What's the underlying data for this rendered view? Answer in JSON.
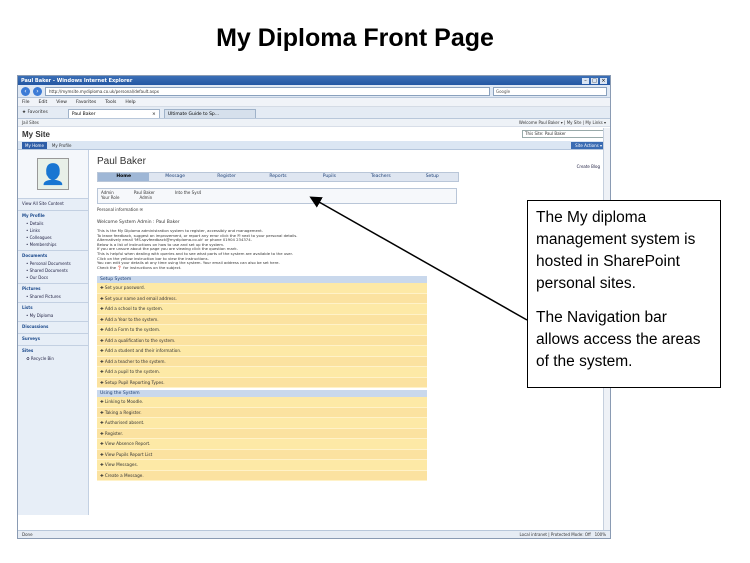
{
  "slide": {
    "title": "My Diploma Front Page"
  },
  "browser": {
    "window_title": "Paul Baker - Windows Internet Explorer",
    "address": "http://mymsite.mydiploma.co.uk/personal/default.aspx",
    "search_placeholder": "Google",
    "menu": [
      "File",
      "Edit",
      "View",
      "Favorites",
      "Tools",
      "Help"
    ],
    "favorites_label": "Favorites",
    "tabs": [
      "Paul Baker",
      "Ultimate Guide to Sp..."
    ],
    "status_left": "Done",
    "status_right": "Local intranet | Protected Mode: Off",
    "zoom": "100%"
  },
  "sharepoint": {
    "top_left": "Jail Sites",
    "welcome": "Welcome Paul Baker ▾ | My Site | My Links ▾",
    "site_title": "My Site",
    "site_search": "This Site: Paul Baker",
    "tabs": [
      "My Home",
      "My Profile"
    ],
    "site_actions": "Site Actions ▾",
    "create_blog": "Create Blog"
  },
  "quicklaunch": {
    "view_all": "View All Site Content",
    "groups": [
      {
        "head": "My Profile",
        "items": [
          "Details",
          "Links",
          "Colleagues",
          "Memberships"
        ]
      },
      {
        "head": "Documents",
        "items": [
          "Personal Documents",
          "Shared Documents",
          "Our Docs"
        ]
      },
      {
        "head": "Pictures",
        "items": [
          "Shared Pictures"
        ]
      },
      {
        "head": "Lists",
        "items": [
          "My Diploma"
        ]
      },
      {
        "head": "Discussions",
        "items": []
      },
      {
        "head": "Surveys",
        "items": []
      },
      {
        "head": "Sites",
        "items": []
      }
    ],
    "recycle": "Recycle Bin"
  },
  "main": {
    "page_title": "Paul Baker",
    "nav": [
      "Home",
      "Message",
      "Register",
      "Reports",
      "Pupils",
      "Teachers",
      "Setup"
    ],
    "info_rows": [
      [
        "Admin",
        "Paul Baker",
        "Into the Sys4"
      ],
      [
        "Your Role",
        "Admin",
        ""
      ]
    ],
    "content_line": "Personal information ✉",
    "welcome": "Welcome System Admin : Paul Baker",
    "paragraph": [
      "This is the My Diploma administration system to register, accessibly and management.",
      "To leave feedback, suggest an improvement, or report any error click the ✉ next to your personal details.",
      "Alternatively email 'MS.spvfeedback@mydiploma.co.uk' or phone 01904 234374.",
      "Below is a list of instructions on how to use and set up the system.",
      "If you are unsure about the page you are viewing click the question mark.",
      "This is helpful when dealing with queries and to see what parts of the system are available to the user.",
      "Click on the yellow instruction bar to view the instructions.",
      "You can edit your details at any time using the system. Your email address can also be set here.",
      "Check the ❓ for instructions on the subject."
    ],
    "setup_section": {
      "head": "Setup System",
      "items": [
        "Set your password.",
        "Set your name and email address.",
        "Add a school to the system.",
        "Add a Year to the system.",
        "Add a Form to the system.",
        "Add a qualification to the system.",
        "Add a student and their information.",
        "Add a teacher to the system.",
        "Add a pupil to the system.",
        "Setup Pupil Reporting Types."
      ]
    },
    "using_section": {
      "head": "Using the System",
      "items": [
        "Linking to Moodle.",
        "Taking a Register.",
        "Authorised absent.",
        "Register.",
        "View Absence Report.",
        "View Pupils Report List",
        "View Messages.",
        "Create a Message."
      ]
    }
  },
  "callout": {
    "p1": "The My diploma management system is hosted in SharePoint personal sites.",
    "p2": "The Navigation bar allows access the areas of the system."
  }
}
